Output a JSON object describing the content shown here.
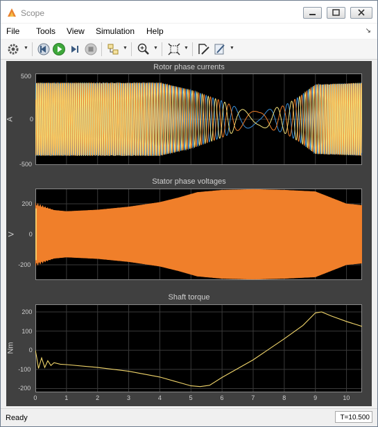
{
  "window": {
    "title": "Scope"
  },
  "menu": {
    "items": [
      "File",
      "Tools",
      "View",
      "Simulation",
      "Help"
    ]
  },
  "toolbar": {
    "icons": [
      "gear-icon",
      "step-back-icon",
      "run-icon",
      "step-forward-icon",
      "stop-icon",
      "signal-select-icon",
      "zoom-icon",
      "autoscale-icon",
      "highlight-block-icon",
      "style-icon"
    ]
  },
  "colors": {
    "blue": "#3a8fd9",
    "orange": "#f07f2a",
    "yellow": "#f5e27a",
    "gold": "#f2d66b",
    "axes_bg": "#000000",
    "panel_bg": "#404040"
  },
  "status": {
    "text": "Ready",
    "time": "T=10.500"
  },
  "chart_data": [
    {
      "type": "line",
      "title": "Rotor phase currents",
      "ylabel": "A",
      "xlim": [
        0,
        10.5
      ],
      "ylim": [
        -500,
        500
      ],
      "yticks": [
        -500,
        0,
        500
      ],
      "xticks": [
        0,
        1,
        2,
        3,
        4,
        5,
        6,
        7,
        8,
        9,
        10
      ],
      "grid": true,
      "series": [
        {
          "color": "blue",
          "amplitude_envelope": [
            [
              0,
              400
            ],
            [
              4,
              400
            ],
            [
              5,
              320
            ],
            [
              6,
              200
            ],
            [
              6.6,
              110
            ],
            [
              7.2,
              80
            ],
            [
              8,
              150
            ],
            [
              8.5,
              250
            ],
            [
              9,
              380
            ],
            [
              10.5,
              400
            ]
          ],
          "phase": 0
        },
        {
          "color": "orange",
          "amplitude_envelope": [
            [
              0,
              400
            ],
            [
              4,
              400
            ],
            [
              5,
              320
            ],
            [
              6,
              200
            ],
            [
              6.6,
              110
            ],
            [
              7.2,
              80
            ],
            [
              8,
              150
            ],
            [
              8.5,
              250
            ],
            [
              9,
              380
            ],
            [
              10.5,
              400
            ]
          ],
          "phase": 2.094
        },
        {
          "color": "yellow",
          "amplitude_envelope": [
            [
              0,
              400
            ],
            [
              4,
              400
            ],
            [
              5,
              320
            ],
            [
              6,
              200
            ],
            [
              6.6,
              110
            ],
            [
              7.2,
              80
            ],
            [
              8,
              150
            ],
            [
              8.5,
              250
            ],
            [
              9,
              380
            ],
            [
              10.5,
              400
            ]
          ],
          "phase": 4.189
        }
      ]
    },
    {
      "type": "area",
      "title": "Stator phase voltages",
      "ylabel": "V",
      "xlim": [
        0,
        10.5
      ],
      "ylim": [
        -300,
        300
      ],
      "yticks": [
        -200,
        0,
        200
      ],
      "xticks": [
        0,
        1,
        2,
        3,
        4,
        5,
        6,
        7,
        8,
        9,
        10
      ],
      "grid": true,
      "series": [
        {
          "color": "orange",
          "envelope": [
            [
              0,
              170
            ],
            [
              1,
              150
            ],
            [
              2,
              160
            ],
            [
              3,
              180
            ],
            [
              4,
              210
            ],
            [
              4.6,
              240
            ],
            [
              5.2,
              275
            ],
            [
              6,
              290
            ],
            [
              7,
              295
            ],
            [
              8,
              290
            ],
            [
              9,
              280
            ],
            [
              9.5,
              240
            ],
            [
              10,
              200
            ],
            [
              10.5,
              190
            ]
          ]
        }
      ]
    },
    {
      "type": "line",
      "title": "Shaft torque",
      "ylabel": "Nm",
      "xlim": [
        0,
        10.5
      ],
      "ylim": [
        -220,
        240
      ],
      "yticks": [
        -200,
        -100,
        0,
        100,
        200
      ],
      "xticks": [
        0,
        1,
        2,
        3,
        4,
        5,
        6,
        7,
        8,
        9,
        10
      ],
      "xtick_labels": [
        "0",
        "1",
        "2",
        "3",
        "4",
        "5",
        "6",
        "7",
        "8",
        "9",
        "10"
      ],
      "grid": true,
      "series": [
        {
          "color": "gold",
          "points": [
            [
              0,
              0
            ],
            [
              0.04,
              -35
            ],
            [
              0.1,
              -95
            ],
            [
              0.2,
              -40
            ],
            [
              0.3,
              -90
            ],
            [
              0.4,
              -55
            ],
            [
              0.5,
              -80
            ],
            [
              0.6,
              -65
            ],
            [
              0.8,
              -73
            ],
            [
              1,
              -75
            ],
            [
              2,
              -90
            ],
            [
              3,
              -110
            ],
            [
              4,
              -140
            ],
            [
              4.5,
              -163
            ],
            [
              5,
              -186
            ],
            [
              5.3,
              -190
            ],
            [
              5.6,
              -183
            ],
            [
              6,
              -142
            ],
            [
              7,
              -50
            ],
            [
              8,
              60
            ],
            [
              8.6,
              130
            ],
            [
              9,
              195
            ],
            [
              9.2,
              200
            ],
            [
              9.5,
              180
            ],
            [
              10,
              150
            ],
            [
              10.5,
              125
            ]
          ]
        }
      ]
    }
  ]
}
